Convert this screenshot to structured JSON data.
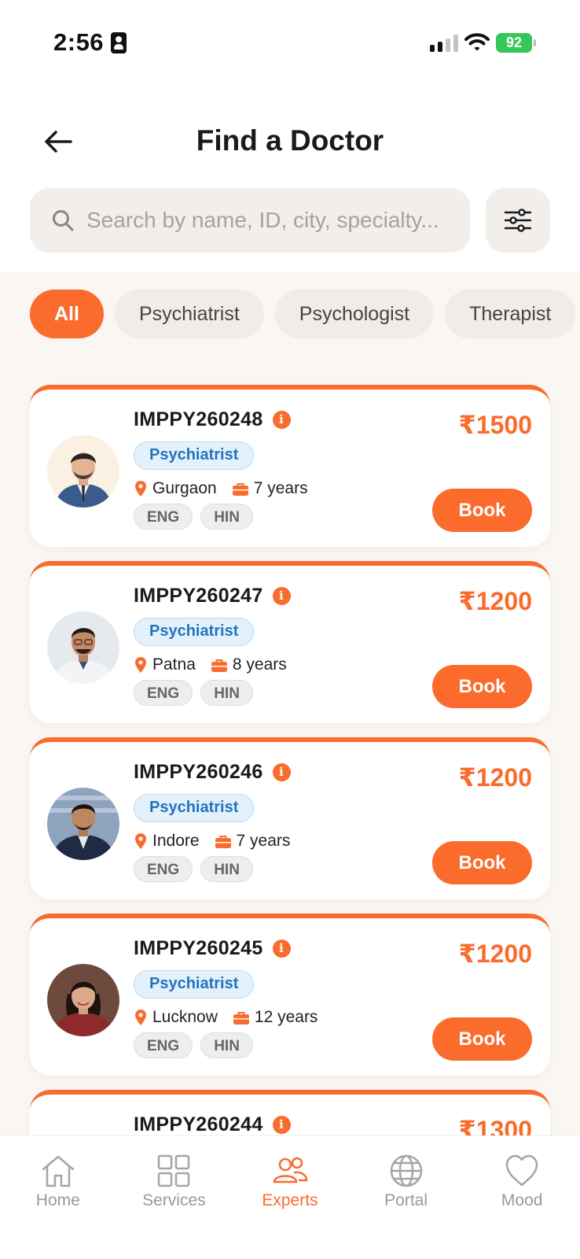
{
  "status_bar": {
    "time": "2:56",
    "battery": "92"
  },
  "header": {
    "title": "Find a Doctor",
    "search_placeholder": "Search by name, ID, city, specialty..."
  },
  "filters": [
    {
      "label": "All",
      "active": true
    },
    {
      "label": "Psychiatrist",
      "active": false
    },
    {
      "label": "Psychologist",
      "active": false
    },
    {
      "label": "Therapist",
      "active": false
    }
  ],
  "doctors": [
    {
      "id": "IMPPY260248",
      "specialty": "Psychiatrist",
      "city": "Gurgaon",
      "experience": "7 years",
      "languages": [
        "ENG",
        "HIN"
      ],
      "price": "₹1500",
      "book_label": "Book"
    },
    {
      "id": "IMPPY260247",
      "specialty": "Psychiatrist",
      "city": "Patna",
      "experience": "8 years",
      "languages": [
        "ENG",
        "HIN"
      ],
      "price": "₹1200",
      "book_label": "Book"
    },
    {
      "id": "IMPPY260246",
      "specialty": "Psychiatrist",
      "city": "Indore",
      "experience": "7 years",
      "languages": [
        "ENG",
        "HIN"
      ],
      "price": "₹1200",
      "book_label": "Book"
    },
    {
      "id": "IMPPY260245",
      "specialty": "Psychiatrist",
      "city": "Lucknow",
      "experience": "12 years",
      "languages": [
        "ENG",
        "HIN"
      ],
      "price": "₹1200",
      "book_label": "Book"
    },
    {
      "id": "IMPPY260244",
      "price": "₹1300"
    }
  ],
  "bottom_nav": [
    {
      "label": "Home",
      "icon": "home-icon",
      "active": false
    },
    {
      "label": "Services",
      "icon": "grid-icon",
      "active": false
    },
    {
      "label": "Experts",
      "icon": "people-icon",
      "active": true
    },
    {
      "label": "Portal",
      "icon": "globe-icon",
      "active": false
    },
    {
      "label": "Mood",
      "icon": "heart-icon",
      "active": false
    }
  ],
  "colors": {
    "accent": "#fa6b2c",
    "specialty_text": "#2374bb",
    "battery": "#34c759"
  }
}
